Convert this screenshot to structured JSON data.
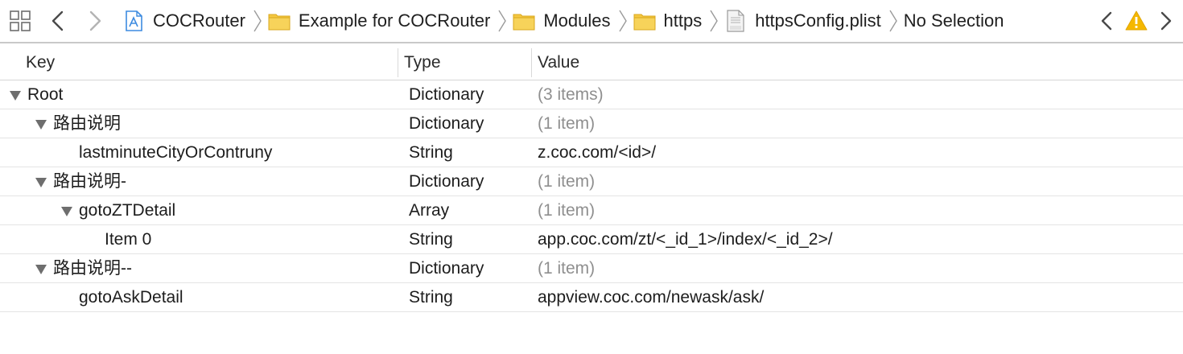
{
  "jumpbar": {
    "breadcrumbs": [
      {
        "label": "COCRouter",
        "icon": "xcode-project-icon"
      },
      {
        "label": "Example for COCRouter",
        "icon": "folder-icon"
      },
      {
        "label": "Modules",
        "icon": "folder-icon"
      },
      {
        "label": "https",
        "icon": "folder-icon"
      },
      {
        "label": "httpsConfig.plist",
        "icon": "plist-file-icon"
      },
      {
        "label": "No Selection",
        "icon": ""
      }
    ],
    "colors": {
      "folder": "#f5c842",
      "warning": "#f5b800",
      "project": "#3d8be0"
    }
  },
  "table": {
    "headers": {
      "key": "Key",
      "type": "Type",
      "value": "Value"
    },
    "rows": [
      {
        "key": "Root",
        "type": "Dictionary",
        "value": "(3 items)",
        "muted": true,
        "expanded": true
      },
      {
        "key": "路由说明",
        "type": "Dictionary",
        "value": "(1 item)",
        "muted": true,
        "expanded": true
      },
      {
        "key": "lastminuteCityOrContruny",
        "type": "String",
        "value": "z.coc.com/<id>/",
        "muted": false
      },
      {
        "key": "路由说明-",
        "type": "Dictionary",
        "value": "(1 item)",
        "muted": true,
        "expanded": true
      },
      {
        "key": "gotoZTDetail",
        "type": "Array",
        "value": "(1 item)",
        "muted": true,
        "expanded": true
      },
      {
        "key": "Item 0",
        "type": "String",
        "value": "app.coc.com/zt/<_id_1>/index/<_id_2>/",
        "muted": false
      },
      {
        "key": "路由说明--",
        "type": "Dictionary",
        "value": "(1 item)",
        "muted": true,
        "expanded": true
      },
      {
        "key": "gotoAskDetail",
        "type": "String",
        "value": "appview.coc.com/newask/ask/",
        "muted": false
      }
    ]
  }
}
